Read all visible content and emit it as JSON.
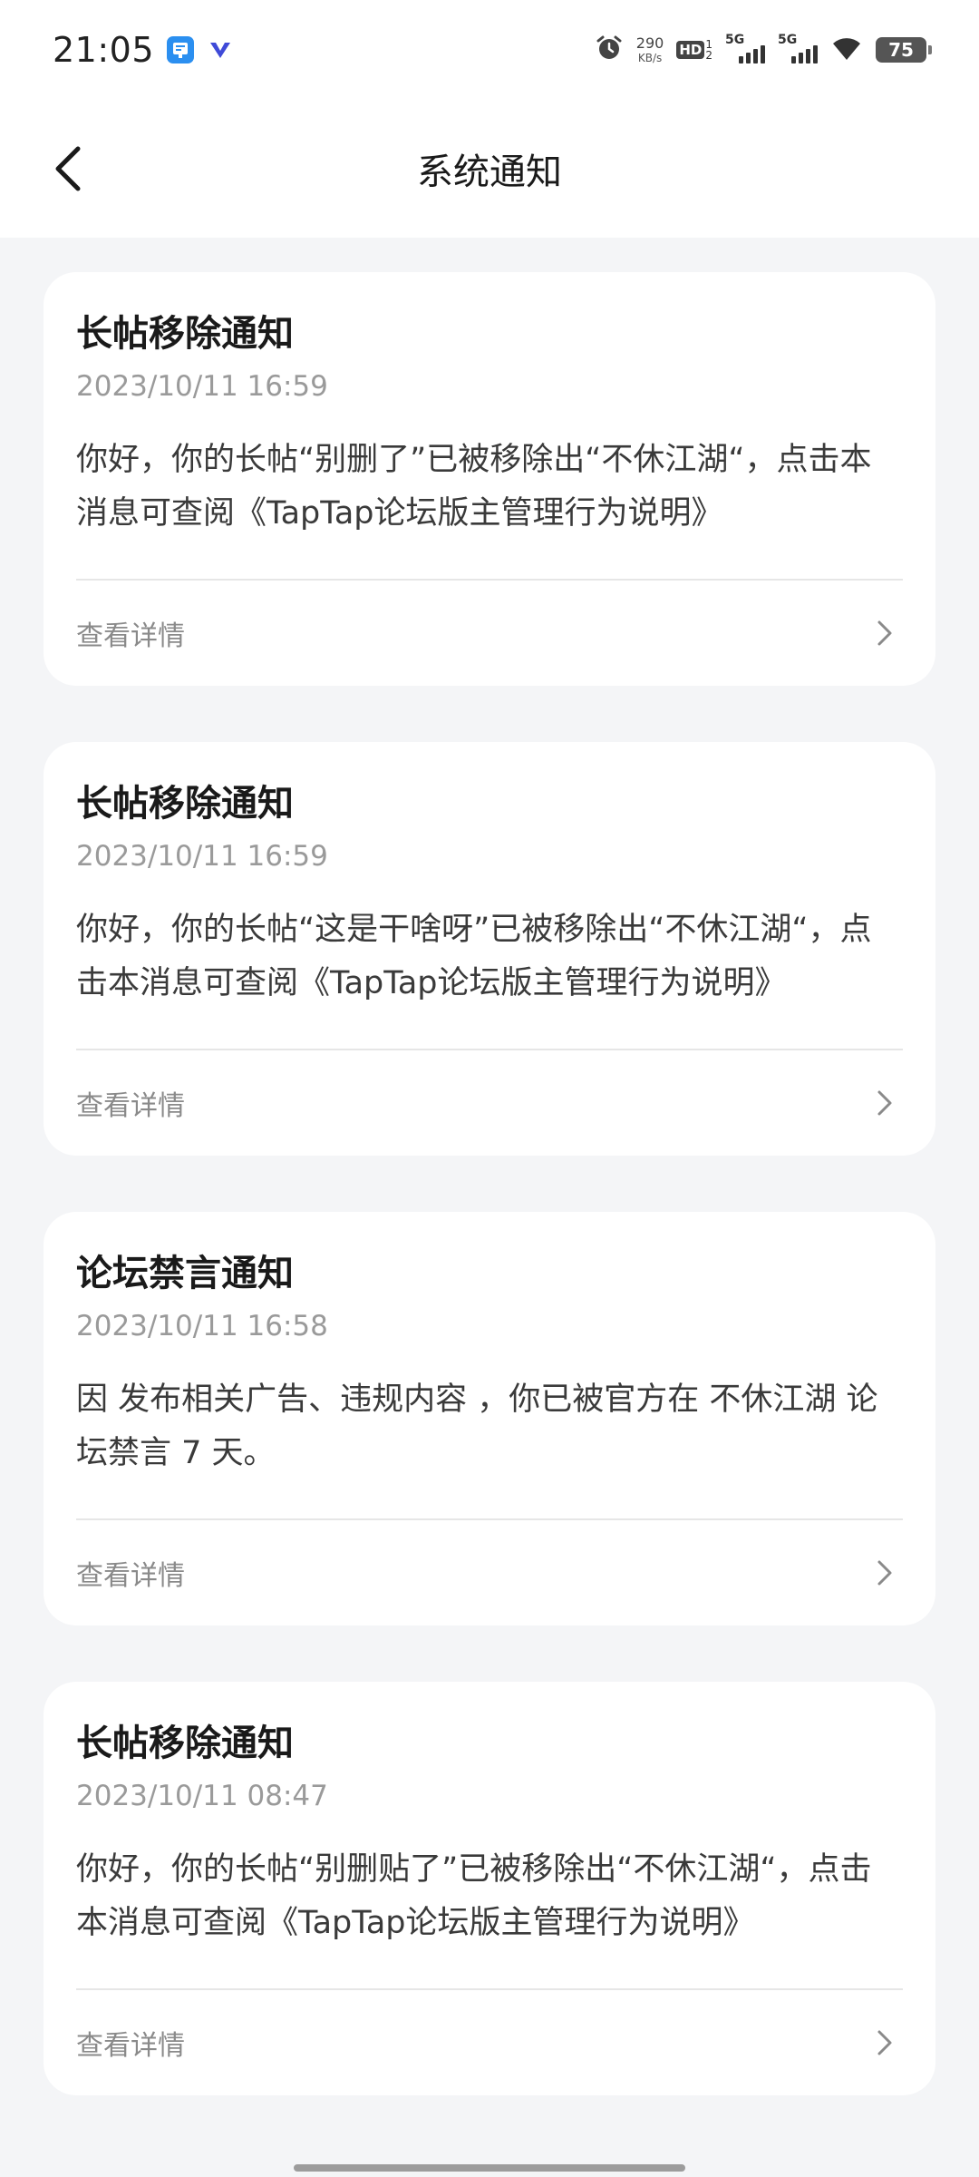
{
  "status_bar": {
    "time": "21:05",
    "net_speed_value": "290",
    "net_speed_unit": "KB/s",
    "hd_label": "HD",
    "hd_sub_top": "1",
    "hd_sub_bottom": "2",
    "sim1_label": "5G",
    "sim2_label": "5G",
    "battery": "75",
    "icons": [
      "app-notification-icon",
      "app-v-icon",
      "alarm-icon",
      "wifi-icon"
    ]
  },
  "header": {
    "title": "系统通知",
    "back_icon": "back-arrow-icon"
  },
  "notifications": [
    {
      "title": "长帖移除通知",
      "time": "2023/10/11 16:59",
      "body": "你好，你的长帖“别删了”已被移除出“不休江湖“，点击本消息可查阅《TapTap论坛版主管理行为说明》",
      "action": "查看详情"
    },
    {
      "title": "长帖移除通知",
      "time": "2023/10/11 16:59",
      "body": "你好，你的长帖“这是干啥呀”已被移除出“不休江湖“，点击本消息可查阅《TapTap论坛版主管理行为说明》",
      "action": "查看详情"
    },
    {
      "title": "论坛禁言通知",
      "time": "2023/10/11 16:58",
      "body": "因 发布相关广告、违规内容 ，你已被官方在 不休江湖 论坛禁言 7 天。",
      "action": "查看详情"
    },
    {
      "title": "长帖移除通知",
      "time": "2023/10/11 08:47",
      "body": "你好，你的长帖“别删贴了”已被移除出“不休江湖“，点击本消息可查阅《TapTap论坛版主管理行为说明》",
      "action": "查看详情"
    }
  ]
}
